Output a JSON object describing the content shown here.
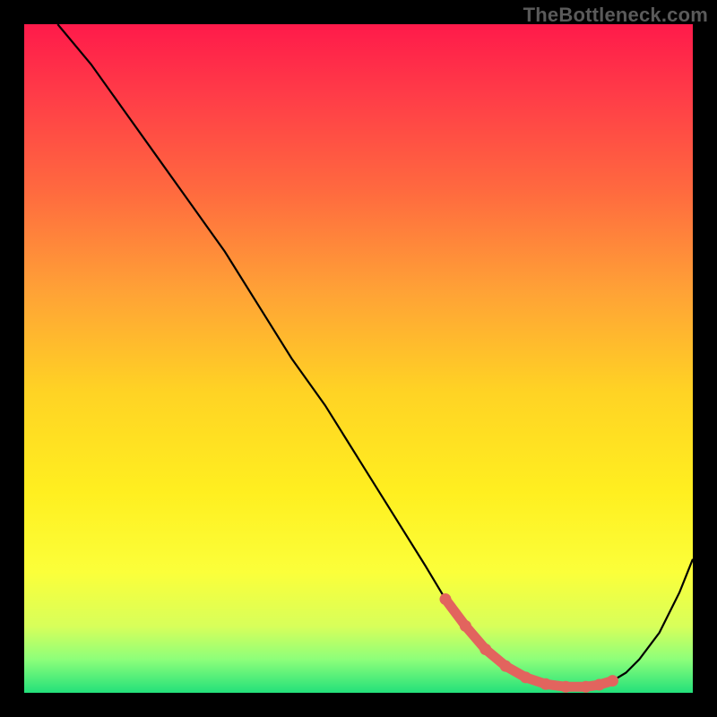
{
  "watermark": "TheBottleneck.com",
  "colors": {
    "bg": "#000000",
    "watermark": "#5a5a5a",
    "curve": "#000000",
    "marker": "#e2645e",
    "gradient_stops": [
      {
        "offset": 0.0,
        "color": "#ff1a4a"
      },
      {
        "offset": 0.1,
        "color": "#ff3a48"
      },
      {
        "offset": 0.25,
        "color": "#ff6a3f"
      },
      {
        "offset": 0.4,
        "color": "#ffa236"
      },
      {
        "offset": 0.55,
        "color": "#ffd324"
      },
      {
        "offset": 0.7,
        "color": "#ffef20"
      },
      {
        "offset": 0.82,
        "color": "#fbff3a"
      },
      {
        "offset": 0.9,
        "color": "#d8ff5a"
      },
      {
        "offset": 0.95,
        "color": "#8dff7a"
      },
      {
        "offset": 1.0,
        "color": "#23e07a"
      }
    ]
  },
  "chart_data": {
    "type": "line",
    "title": "",
    "xlabel": "",
    "ylabel": "",
    "xlim": [
      0,
      100
    ],
    "ylim": [
      0,
      100
    ],
    "series": [
      {
        "name": "curve",
        "x": [
          5,
          10,
          15,
          20,
          25,
          30,
          35,
          40,
          45,
          50,
          55,
          60,
          63,
          66,
          69,
          72,
          75,
          78,
          81,
          84,
          86,
          88,
          90,
          92,
          95,
          98,
          100
        ],
        "y": [
          100,
          94,
          87,
          80,
          73,
          66,
          58,
          50,
          43,
          35,
          27,
          19,
          14,
          10,
          6.5,
          4,
          2.3,
          1.3,
          0.9,
          0.9,
          1.2,
          1.8,
          3,
          5,
          9,
          15,
          20
        ]
      }
    ],
    "markers": {
      "name": "highlight",
      "color": "#e2645e",
      "x": [
        63,
        66,
        69,
        72,
        75,
        78,
        81,
        84,
        86,
        88
      ],
      "y": [
        14,
        10,
        6.5,
        4,
        2.3,
        1.3,
        0.9,
        0.9,
        1.2,
        1.8
      ]
    }
  }
}
